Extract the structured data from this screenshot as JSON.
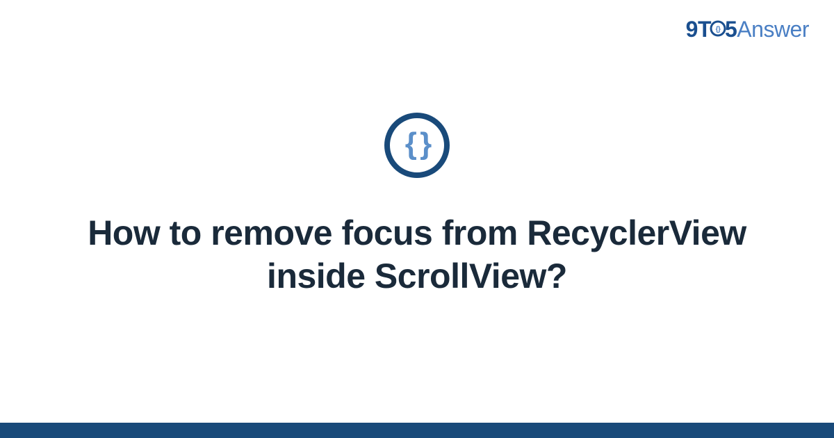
{
  "brand": {
    "prefix": "9T",
    "middle": "5",
    "suffix": "Answer"
  },
  "logo": {
    "braces": "{ }"
  },
  "question": {
    "title": "How to remove focus from RecyclerView inside ScrollView?"
  },
  "colors": {
    "primary": "#194a7a",
    "secondary": "#4a7fc4",
    "text": "#1a2a3a"
  }
}
